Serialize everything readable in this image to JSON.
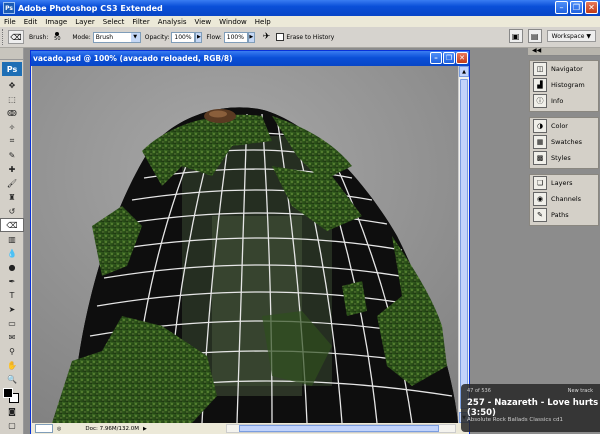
{
  "app": {
    "title": "Adobe Photoshop CS3 Extended",
    "logo_mini": "Ps",
    "logo": "Ps"
  },
  "menu": [
    "File",
    "Edit",
    "Image",
    "Layer",
    "Select",
    "Filter",
    "Analysis",
    "View",
    "Window",
    "Help"
  ],
  "options": {
    "brush_label": "Brush:",
    "brush_size": "50",
    "mode_label": "Mode:",
    "mode_value": "Brush",
    "opacity_label": "Opacity:",
    "opacity_value": "100%",
    "flow_label": "Flow:",
    "flow_value": "100%",
    "erase_history_label": "Erase to History",
    "workspace_label": "Workspace ▼"
  },
  "document": {
    "title": "vacado.psd @ 100% (avacado reloaded, RGB/8)",
    "doc_info": "Doc: 7.96M/132.0M"
  },
  "panels": {
    "group1": [
      "Navigator",
      "Histogram",
      "Info"
    ],
    "group2": [
      "Color",
      "Swatches",
      "Styles"
    ],
    "group3": [
      "Layers",
      "Channels",
      "Paths"
    ]
  },
  "music": {
    "position": "47 of 536",
    "new_track": "New track",
    "track": "257 - Nazareth - Love hurts (3:50)",
    "album": "Absolute Rock Ballads Classics cd1"
  },
  "colors": {
    "xp_blue": "#0a4fd8",
    "panel_gray": "#d4d0c8",
    "canvas_gray": "#8a8a8a"
  }
}
